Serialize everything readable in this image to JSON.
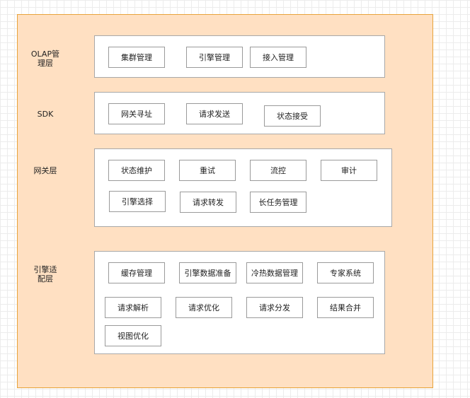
{
  "layers": {
    "olap": {
      "label": "OLAP管\n理层",
      "items": [
        "集群管理",
        "引擎管理",
        "接入管理"
      ]
    },
    "sdk": {
      "label": "SDK",
      "items": [
        "网关寻址",
        "请求发送",
        "状态接受"
      ]
    },
    "gateway": {
      "label": "网关层",
      "items": [
        "状态维护",
        "重试",
        "流控",
        "审计",
        "引擎选择",
        "请求转发",
        "长任务管理"
      ]
    },
    "engine": {
      "label": "引擎适\n配层",
      "items": [
        "缓存管理",
        "引擎数据准备",
        "冷热数据管理",
        "专家系统",
        "请求解析",
        "请求优化",
        "请求分发",
        "结果合并",
        "视图优化"
      ]
    }
  },
  "colors": {
    "outer_fill": "#ffe0c2",
    "outer_border": "#e8a33a",
    "panel_border": "#a8a8a8",
    "box_border": "#9a9a9a"
  }
}
